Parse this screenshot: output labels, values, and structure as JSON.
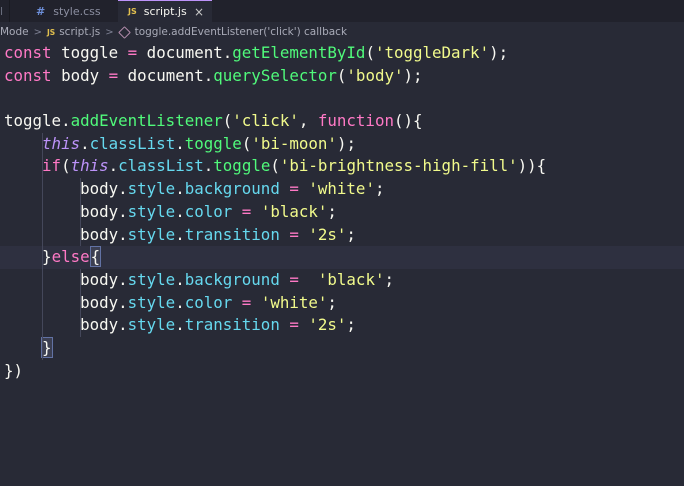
{
  "tabs": [
    {
      "label": "l"
    },
    {
      "label": "style.css",
      "icon": "css-hash-icon",
      "glyph": "#"
    },
    {
      "label": "script.js",
      "icon": "js-file-icon",
      "glyph": "JS",
      "close": "×",
      "active": true
    }
  ],
  "breadcrumb": {
    "items": [
      "Mode",
      "script.js",
      "toggle.addEventListener('click') callback"
    ],
    "sep": ">",
    "js_glyph": "JS"
  },
  "colors": {
    "background": "#282a36",
    "keyword": "#ff79c6",
    "function": "#50fa7b",
    "string": "#f1fa8c",
    "property": "#66d9ef",
    "this": "#bd93f9"
  },
  "code_lines": [
    [
      [
        "kw",
        "const"
      ],
      [
        "plain",
        " toggle "
      ],
      [
        "kw",
        "="
      ],
      [
        "plain",
        " document."
      ],
      [
        "fn",
        "getElementById"
      ],
      [
        "plain",
        "("
      ],
      [
        "str",
        "'toggleDark'"
      ],
      [
        "plain",
        ");"
      ]
    ],
    [
      [
        "kw",
        "const"
      ],
      [
        "plain",
        " body "
      ],
      [
        "kw",
        "="
      ],
      [
        "plain",
        " document."
      ],
      [
        "fn",
        "querySelector"
      ],
      [
        "plain",
        "("
      ],
      [
        "str",
        "'body'"
      ],
      [
        "plain",
        ");"
      ]
    ],
    [],
    [
      [
        "plain",
        "toggle."
      ],
      [
        "fn",
        "addEventListener"
      ],
      [
        "plain",
        "("
      ],
      [
        "str",
        "'click'"
      ],
      [
        "plain",
        ", "
      ],
      [
        "fnkw",
        "function"
      ],
      [
        "plain",
        "(){"
      ]
    ],
    [
      [
        "plain",
        "    "
      ],
      [
        "this",
        "this"
      ],
      [
        "plain",
        "."
      ],
      [
        "prop",
        "classList"
      ],
      [
        "plain",
        "."
      ],
      [
        "fn",
        "toggle"
      ],
      [
        "plain",
        "("
      ],
      [
        "str",
        "'bi-moon'"
      ],
      [
        "plain",
        ");"
      ]
    ],
    [
      [
        "plain",
        "    "
      ],
      [
        "kw",
        "if"
      ],
      [
        "plain",
        "("
      ],
      [
        "this",
        "this"
      ],
      [
        "plain",
        "."
      ],
      [
        "prop",
        "classList"
      ],
      [
        "plain",
        "."
      ],
      [
        "fn",
        "toggle"
      ],
      [
        "plain",
        "("
      ],
      [
        "str",
        "'bi-brightness-high-fill'"
      ],
      [
        "plain",
        "))"
      ],
      [
        "plain",
        "{"
      ]
    ],
    [
      [
        "plain",
        "        body."
      ],
      [
        "prop",
        "style"
      ],
      [
        "plain",
        "."
      ],
      [
        "prop",
        "background"
      ],
      [
        "plain",
        " "
      ],
      [
        "kw",
        "="
      ],
      [
        "plain",
        " "
      ],
      [
        "str",
        "'white'"
      ],
      [
        "plain",
        ";"
      ]
    ],
    [
      [
        "plain",
        "        body."
      ],
      [
        "prop",
        "style"
      ],
      [
        "plain",
        "."
      ],
      [
        "prop",
        "color"
      ],
      [
        "plain",
        " "
      ],
      [
        "kw",
        "="
      ],
      [
        "plain",
        " "
      ],
      [
        "str",
        "'black'"
      ],
      [
        "plain",
        ";"
      ]
    ],
    [
      [
        "plain",
        "        body."
      ],
      [
        "prop",
        "style"
      ],
      [
        "plain",
        "."
      ],
      [
        "prop",
        "transition"
      ],
      [
        "plain",
        " "
      ],
      [
        "kw",
        "="
      ],
      [
        "plain",
        " "
      ],
      [
        "str",
        "'2s'"
      ],
      [
        "plain",
        ";"
      ]
    ],
    [
      [
        "plain",
        "    }"
      ],
      [
        "kw",
        "else"
      ],
      [
        "match",
        "{"
      ]
    ],
    [
      [
        "plain",
        "        body."
      ],
      [
        "prop",
        "style"
      ],
      [
        "plain",
        "."
      ],
      [
        "prop",
        "background"
      ],
      [
        "plain",
        " "
      ],
      [
        "kw",
        "="
      ],
      [
        "plain",
        "  "
      ],
      [
        "str",
        "'black'"
      ],
      [
        "plain",
        ";"
      ]
    ],
    [
      [
        "plain",
        "        body."
      ],
      [
        "prop",
        "style"
      ],
      [
        "plain",
        "."
      ],
      [
        "prop",
        "color"
      ],
      [
        "plain",
        " "
      ],
      [
        "kw",
        "="
      ],
      [
        "plain",
        " "
      ],
      [
        "str",
        "'white'"
      ],
      [
        "plain",
        ";"
      ]
    ],
    [
      [
        "plain",
        "        body."
      ],
      [
        "prop",
        "style"
      ],
      [
        "plain",
        "."
      ],
      [
        "prop",
        "transition"
      ],
      [
        "plain",
        " "
      ],
      [
        "kw",
        "="
      ],
      [
        "plain",
        " "
      ],
      [
        "str",
        "'2s'"
      ],
      [
        "plain",
        ";"
      ]
    ],
    [
      [
        "plain",
        "    "
      ],
      [
        "match",
        "}"
      ]
    ],
    [
      [
        "plain",
        "})"
      ]
    ]
  ],
  "current_line": 9
}
